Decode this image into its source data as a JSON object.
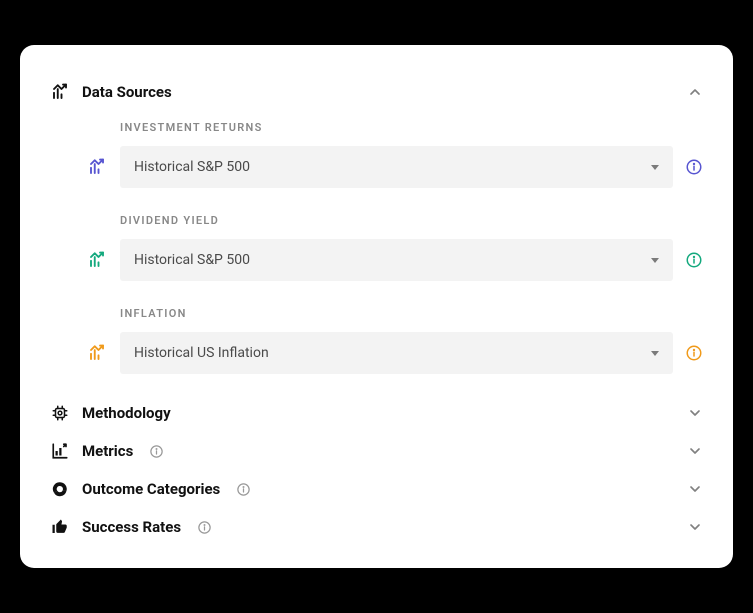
{
  "sections": {
    "data_sources": {
      "title": "Data Sources",
      "expanded": true,
      "fields": {
        "investment_returns": {
          "label": "INVESTMENT RETURNS",
          "value": "Historical S&P 500",
          "accent": "#5755d1"
        },
        "dividend_yield": {
          "label": "DIVIDEND YIELD",
          "value": "Historical S&P 500",
          "accent": "#14a97e"
        },
        "inflation": {
          "label": "INFLATION",
          "value": "Historical US Inflation",
          "accent": "#f09a1a"
        }
      }
    },
    "methodology": {
      "title": "Methodology",
      "expanded": false,
      "has_info": false
    },
    "metrics": {
      "title": "Metrics",
      "expanded": false,
      "has_info": true
    },
    "outcome_categories": {
      "title": "Outcome Categories",
      "expanded": false,
      "has_info": true
    },
    "success_rates": {
      "title": "Success Rates",
      "expanded": false,
      "has_info": true
    }
  }
}
